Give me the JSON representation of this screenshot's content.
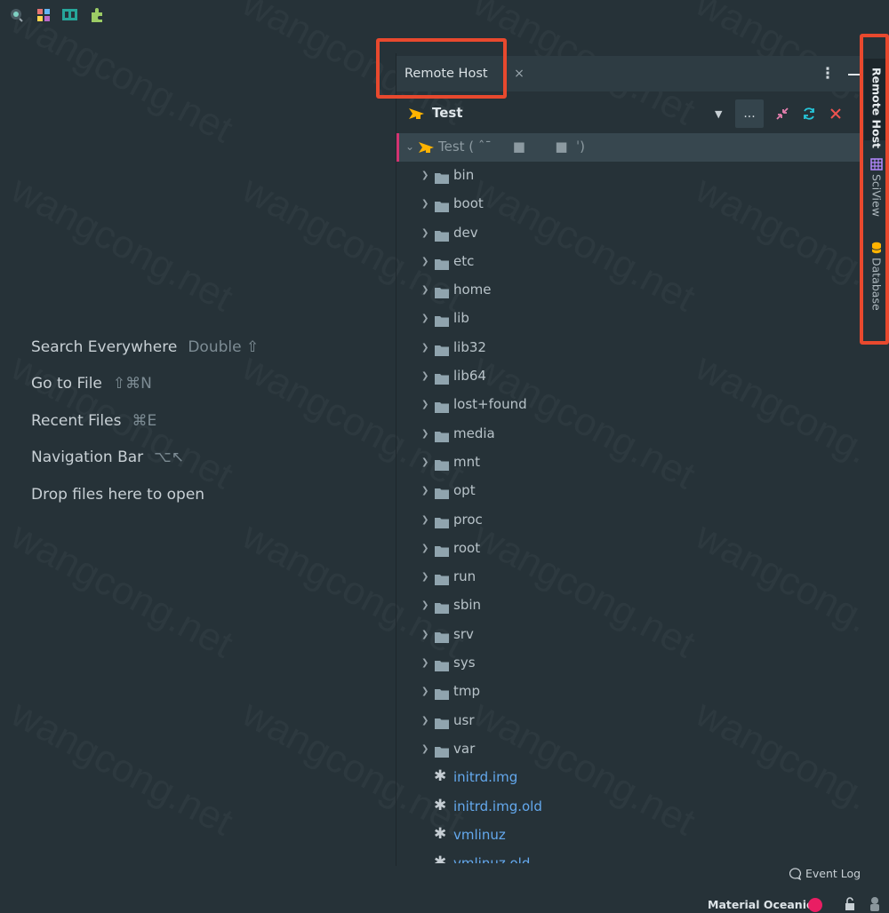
{
  "watermark": "wangcong.net",
  "toolbar": {
    "icons": [
      "search-everywhere-icon",
      "structure-icon",
      "plugin-ui-icon",
      "plugins-icon"
    ]
  },
  "welcome": {
    "items": [
      {
        "label": "Search Everywhere",
        "shortcut": "Double ⇧"
      },
      {
        "label": "Go to File",
        "shortcut": "⇧⌘N"
      },
      {
        "label": "Recent Files",
        "shortcut": "⌘E"
      },
      {
        "label": "Navigation Bar",
        "shortcut": "⌥↖"
      },
      {
        "label": "Drop files here to open",
        "shortcut": ""
      }
    ]
  },
  "tool_window": {
    "tab_label": "Remote Host",
    "close_glyph": "×",
    "options_glyph": "⋮",
    "host": {
      "name": "Test",
      "more_label": "...",
      "root_label": "Test ( ˆˉ     ■       ■  ˈ)"
    },
    "folders": [
      "bin",
      "boot",
      "dev",
      "etc",
      "home",
      "lib",
      "lib32",
      "lib64",
      "lost+found",
      "media",
      "mnt",
      "opt",
      "proc",
      "root",
      "run",
      "sbin",
      "srv",
      "sys",
      "tmp",
      "usr",
      "var"
    ],
    "files": [
      "initrd.img",
      "initrd.img.old",
      "vmlinuz",
      "vmlinuz.old"
    ]
  },
  "right_stripe": {
    "items": [
      {
        "label": "Remote Host",
        "active": true
      },
      {
        "label": "SciView",
        "active": false
      },
      {
        "label": "Database",
        "active": false
      }
    ]
  },
  "status": {
    "event_log": "Event Log",
    "theme": "Material Oceanic"
  },
  "colors": {
    "background": "#263238",
    "accent_pink": "#e91e63",
    "highlight_red": "#e8492e",
    "link_blue": "#64a9ee",
    "folder": "#90a4ae"
  }
}
